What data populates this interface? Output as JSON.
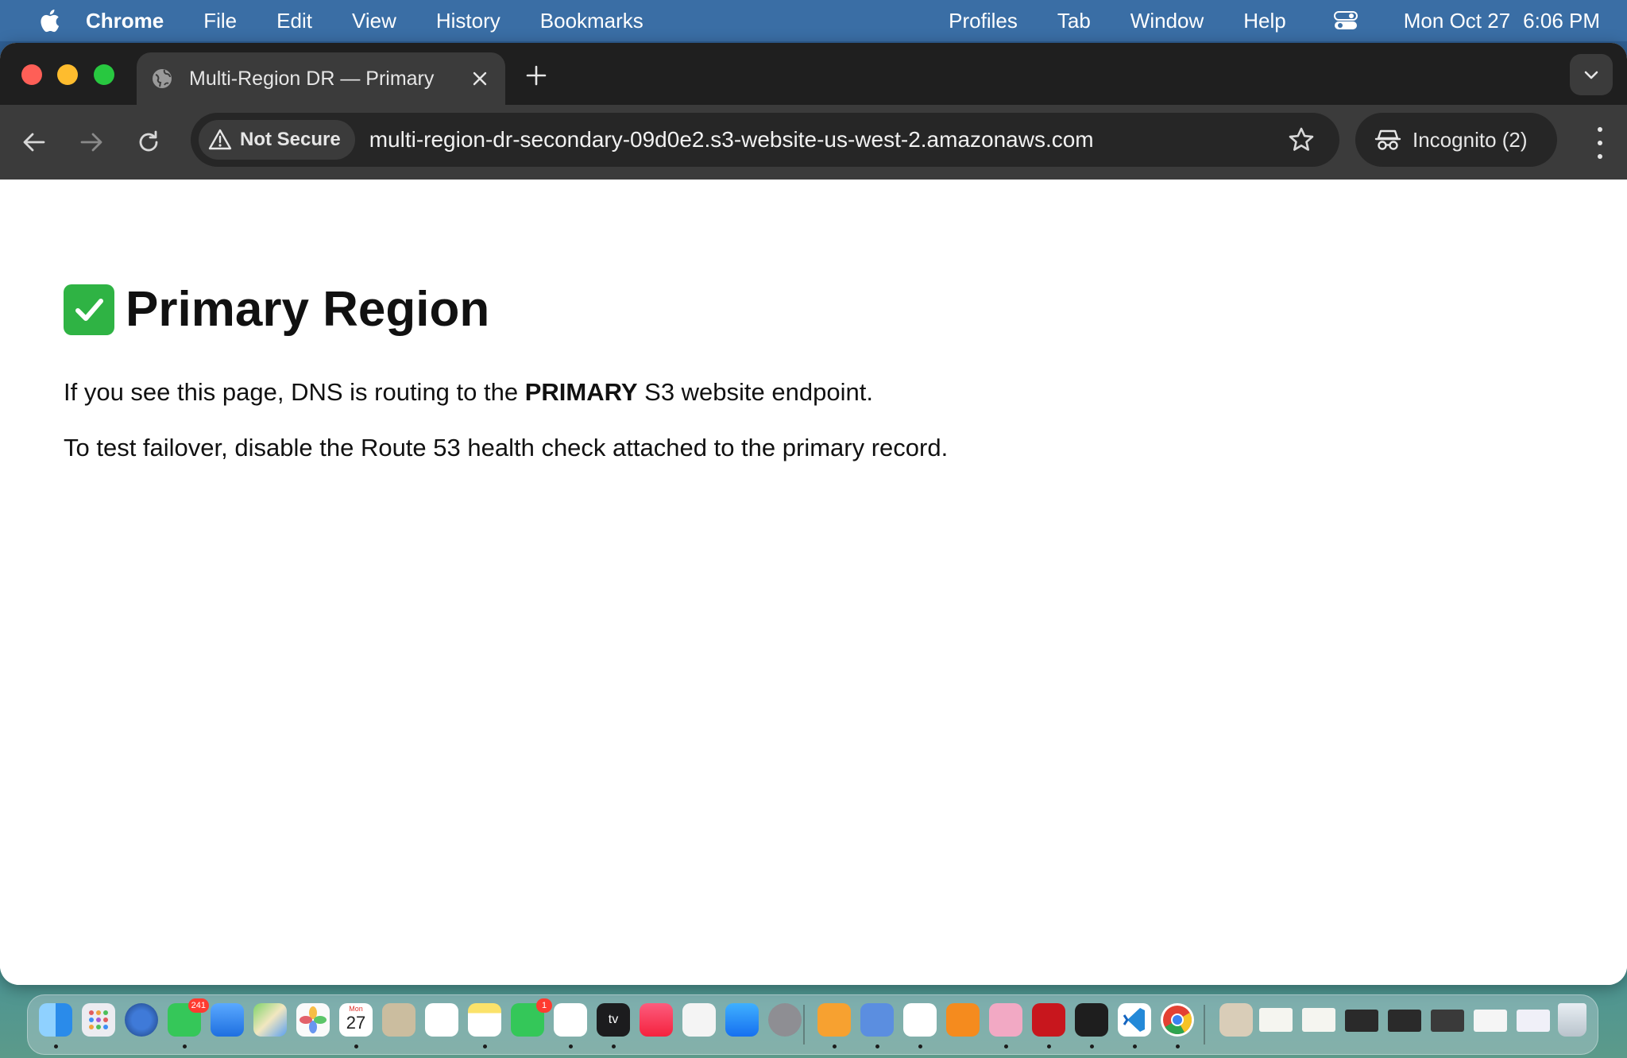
{
  "menubar": {
    "app_name": "Chrome",
    "items": [
      "File",
      "Edit",
      "View",
      "History",
      "Bookmarks"
    ],
    "right_items": [
      "Profiles",
      "Tab",
      "Window",
      "Help"
    ],
    "date": "Mon Oct 27",
    "time": "6:06 PM"
  },
  "browser": {
    "tab_title": "Multi-Region DR — Primary",
    "security_label": "Not Secure",
    "url": "multi-region-dr-secondary-09d0e2.s3-website-us-west-2.amazonaws.com",
    "incognito_label": "Incognito (2)"
  },
  "page": {
    "heading": "Primary Region",
    "p1_before": "If you see this page, DNS is routing to the ",
    "p1_bold": "PRIMARY",
    "p1_after": " S3 website endpoint.",
    "p2": "To test failover, disable the Route 53 health check attached to the primary record."
  },
  "dock": {
    "messages_badge": "241",
    "facetime_badge": "1",
    "calendar_month": "Mon",
    "calendar_day": "27",
    "tv_label": "tv",
    "icons": [
      {
        "name": "finder-icon",
        "color": "#3b8fe8"
      },
      {
        "name": "launchpad-icon",
        "color": "#e8e8ee"
      },
      {
        "name": "safari-icon",
        "color": "#2a5db0"
      },
      {
        "name": "messages-icon",
        "color": "#35c759"
      },
      {
        "name": "mail-icon",
        "color": "#3d8ef5"
      },
      {
        "name": "maps-icon",
        "color": "#5cc36a"
      },
      {
        "name": "photos-icon",
        "color": "#f5f5f5"
      },
      {
        "name": "calendar-icon",
        "color": "#ffffff"
      },
      {
        "name": "contacts-icon",
        "color": "#c9b99a"
      },
      {
        "name": "reminders-icon",
        "color": "#ffffff"
      },
      {
        "name": "notes-icon",
        "color": "#fbe26a"
      },
      {
        "name": "facetime-icon",
        "color": "#34c759"
      },
      {
        "name": "freeform-icon",
        "color": "#ffffff"
      },
      {
        "name": "apple-tv-icon",
        "color": "#1c1c1e"
      },
      {
        "name": "music-icon",
        "color": "#fa2d48"
      },
      {
        "name": "news-icon",
        "color": "#f0f0f0"
      },
      {
        "name": "app-store-icon",
        "color": "#1e8cf5"
      },
      {
        "name": "system-settings-icon",
        "color": "#8e8e93"
      },
      {
        "name": "pages-icon",
        "color": "#f7a130"
      },
      {
        "name": "disk-utility-icon",
        "color": "#5b8ee0"
      },
      {
        "name": "textedit-icon",
        "color": "#ffffff"
      },
      {
        "name": "books-icon",
        "color": "#f58b1e"
      },
      {
        "name": "affinity-icon",
        "color": "#f2a9c4"
      },
      {
        "name": "acrobat-icon",
        "color": "#c8161d"
      },
      {
        "name": "terminal-icon",
        "color": "#1e1e1e"
      },
      {
        "name": "vscode-icon",
        "color": "#ffffff"
      },
      {
        "name": "chrome-icon",
        "color": "#ffffff"
      }
    ],
    "recent_icons": [
      "recent-photo-icon",
      "recent-doc-1-icon",
      "recent-doc-2-icon",
      "recent-window-1-icon",
      "recent-window-2-icon",
      "recent-window-3-icon",
      "recent-window-4-icon",
      "recent-window-5-icon",
      "trash-icon"
    ]
  }
}
